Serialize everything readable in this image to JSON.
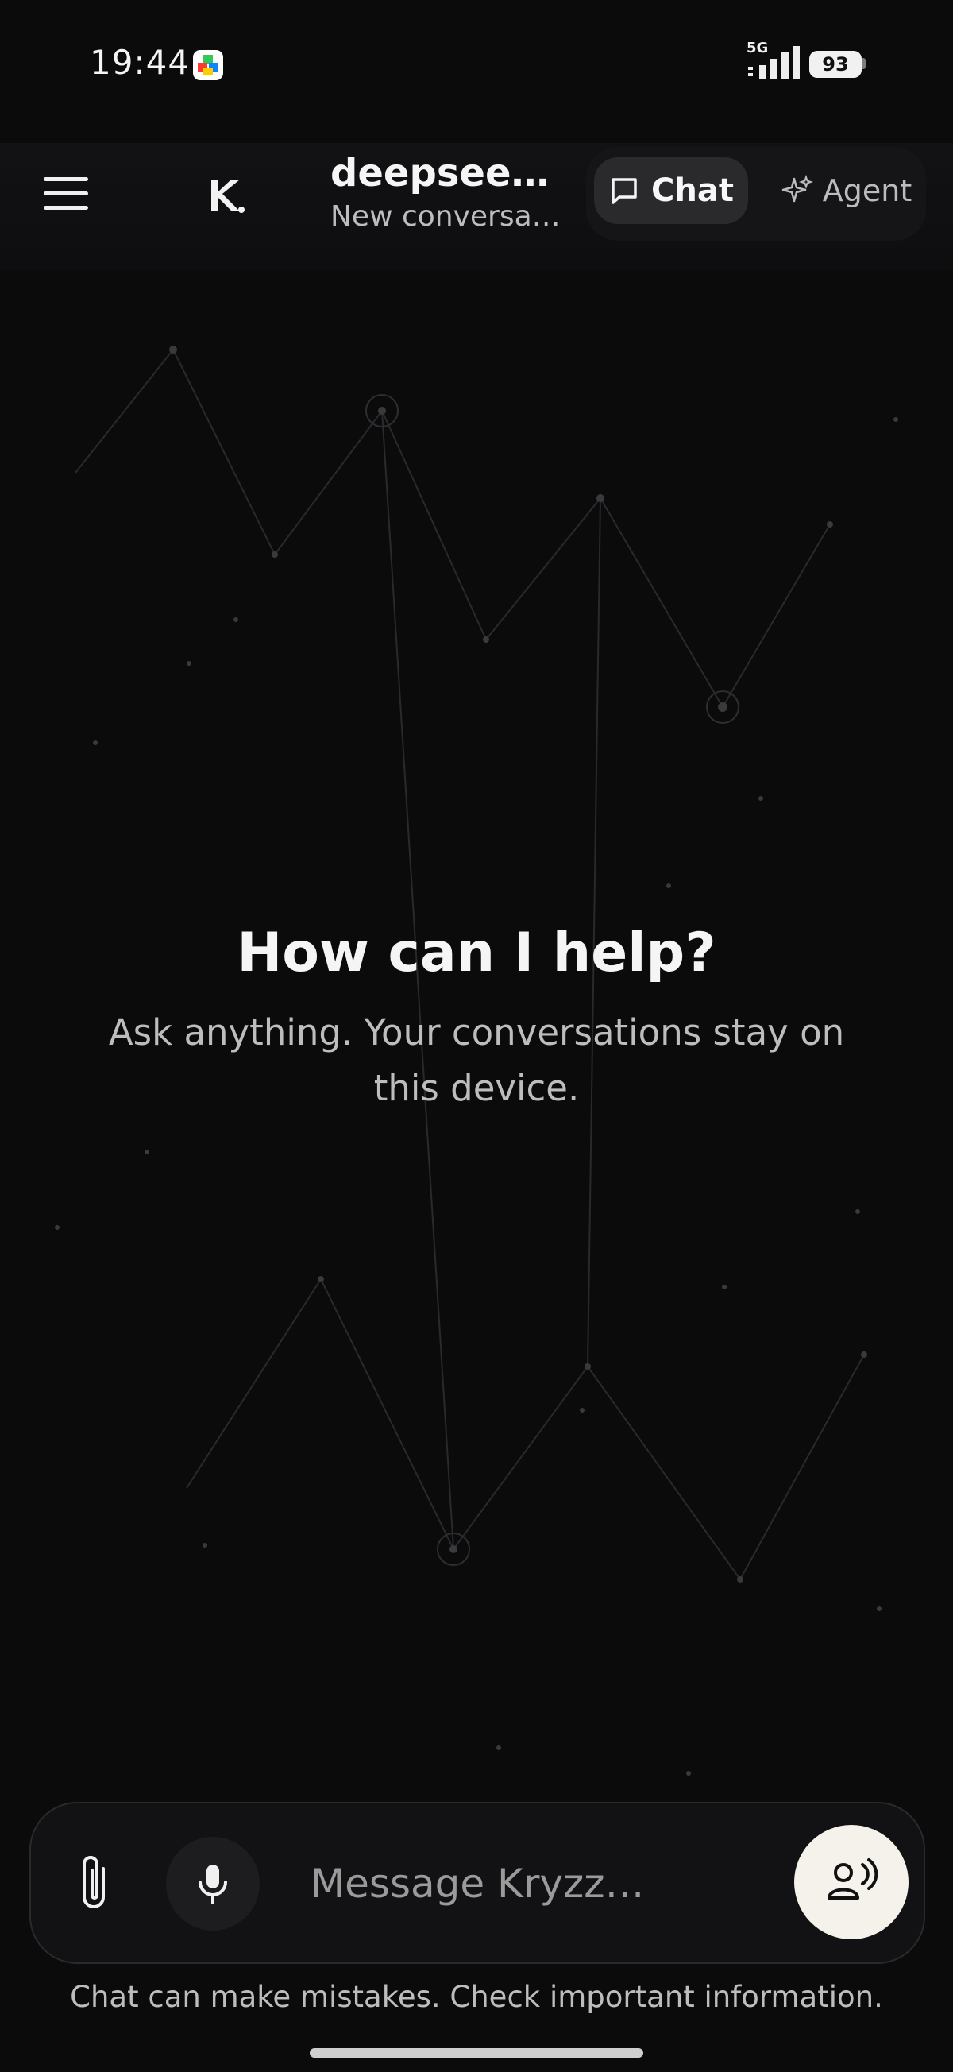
{
  "status_bar": {
    "time": "19:44",
    "network": "5G",
    "battery": "93",
    "notification_app_icon": "colorful-app-icon"
  },
  "header": {
    "menu_icon": "hamburger-menu-icon",
    "logo_icon": "kryzz-logo-icon",
    "model_title": "deepseek-…",
    "conversation_subtitle": "New conversa…",
    "modes": [
      {
        "label": "Chat",
        "icon": "chat-bubble-icon",
        "selected": true
      },
      {
        "label": "Agent",
        "icon": "sparkle-icon",
        "selected": false
      }
    ]
  },
  "hero": {
    "title": "How can I help?",
    "subtitle": "Ask anything. Your conversations stay on this device."
  },
  "composer": {
    "attach_icon": "paperclip-icon",
    "mic_icon": "microphone-icon",
    "placeholder": "Message Kryzz…",
    "voice_icon": "voice-mode-icon"
  },
  "footer": {
    "disclaimer": "Chat can make mistakes. Check important information."
  },
  "colors": {
    "background": "#0b0b0c",
    "accent_button": "#f4f2ea",
    "selected_mode": "#2a2a2d"
  }
}
